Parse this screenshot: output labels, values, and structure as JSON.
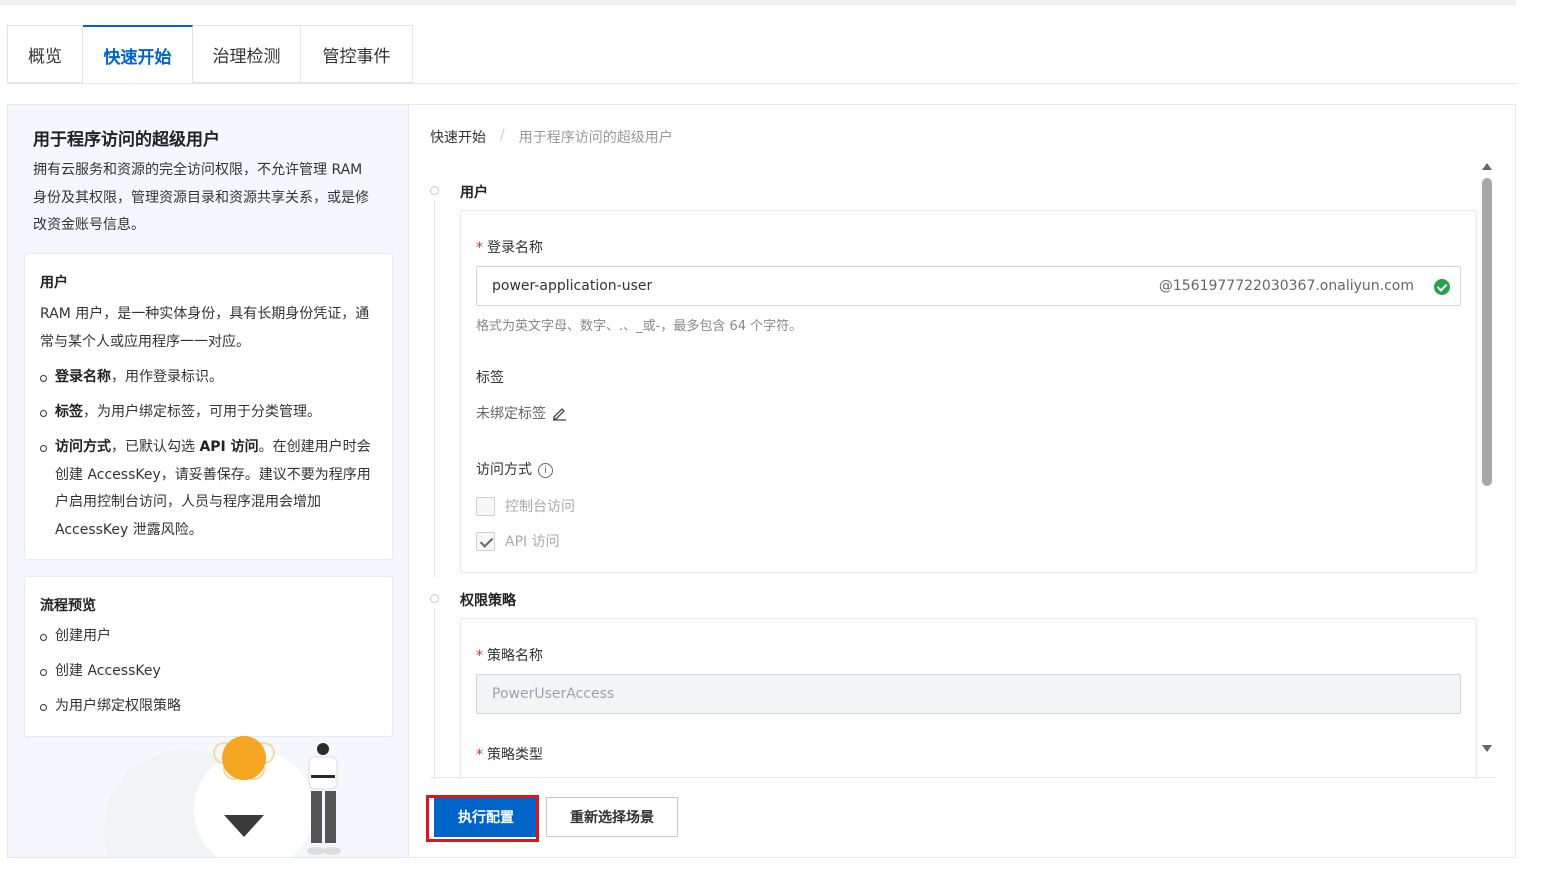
{
  "tabs": [
    {
      "label": "概览",
      "active": false
    },
    {
      "label": "快速开始",
      "active": true
    },
    {
      "label": "治理检测",
      "active": false
    },
    {
      "label": "管控事件",
      "active": false
    }
  ],
  "sidebar": {
    "title": "用于程序访问的超级用户",
    "description": "拥有云服务和资源的完全访问权限，不允许管理 RAM 身份及其权限，管理资源目录和资源共享关系，或是修改资金账号信息。",
    "user_card": {
      "title": "用户",
      "text": "RAM 用户，是一种实体身份，具有长期身份凭证，通常与某个人或应用程序一一对应。",
      "bullets": [
        {
          "strong": "登录名称",
          "text": "，用作登录标识。"
        },
        {
          "strong": "标签",
          "text": "，为用户绑定标签，可用于分类管理。"
        },
        {
          "strong": "访问方式",
          "text": "，已默认勾选 ",
          "strong2": "API 访问",
          "text2": "。在创建用户时会创建 AccessKey，请妥善保存。建议不要为程序用户启用控制台访问，人员与程序混用会增加 AccessKey 泄露风险。"
        }
      ]
    },
    "flow_card": {
      "title": "流程预览",
      "items": [
        "创建用户",
        "创建 AccessKey",
        "为用户绑定权限策略"
      ]
    }
  },
  "breadcrumb": {
    "root": "快速开始",
    "separator": "/",
    "current": "用于程序访问的超级用户"
  },
  "user_step": {
    "title": "用户",
    "login_label": "登录名称",
    "login_value": "power-application-user",
    "login_suffix": "@1561977722030367.onaliyun.com",
    "login_hint": "格式为英文字母、数字、.、_或-，最多包含 64 个字符。",
    "tag_label": "标签",
    "tag_value": "未绑定标签",
    "access_label": "访问方式",
    "access_options": [
      {
        "label": "控制台访问",
        "checked": false
      },
      {
        "label": "API 访问",
        "checked": true
      }
    ]
  },
  "policy_step": {
    "title": "权限策略",
    "name_label": "策略名称",
    "name_value": "PowerUserAccess",
    "type_label": "策略类型"
  },
  "actions": {
    "execute": "执行配置",
    "reselect": "重新选择场景"
  },
  "colors": {
    "primary": "#0064c8",
    "highlight_border": "#e0141e",
    "success": "#2aa149",
    "required": "#d93026"
  }
}
